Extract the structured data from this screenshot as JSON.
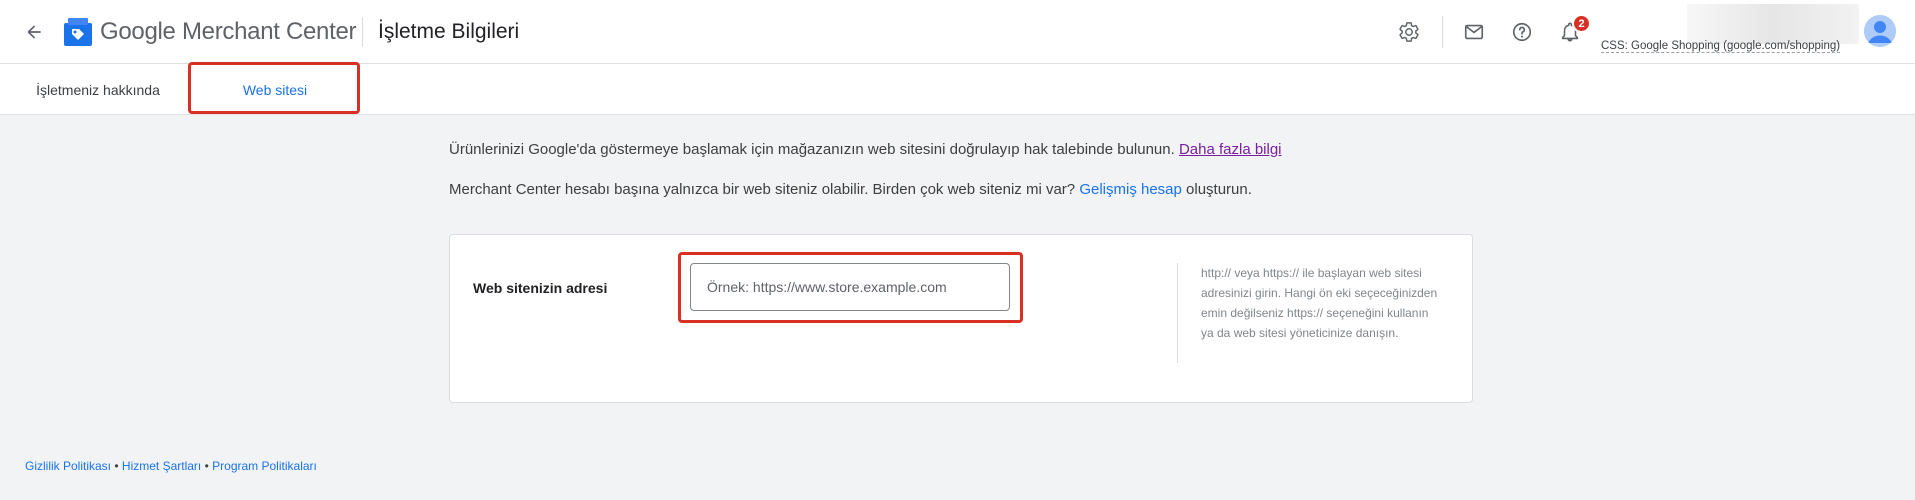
{
  "header": {
    "brand_google": "Google",
    "brand_product": "Merchant Center",
    "page_title": "İşletme Bilgileri",
    "notification_count": "2",
    "account_css": "CSS: Google Shopping (google.com/shopping)",
    "icons": [
      "back-arrow-icon",
      "merchant-center-logo",
      "settings-icon",
      "mail-icon",
      "help-icon",
      "notifications-icon",
      "avatar"
    ],
    "accent_color": "#1a73e8"
  },
  "tabs": [
    {
      "label": "İşletmeniz hakkında",
      "active": false
    },
    {
      "label": "Web sitesi",
      "active": true
    }
  ],
  "intro": {
    "line1_text": "Ürünlerinizi Google'da göstermeye başlamak için mağazanızın web sitesini doğrulayıp hak talebinde bulunun.",
    "line1_link": "Daha fazla bilgi",
    "line2_before": "Merchant Center hesabı başına yalnızca bir web siteniz olabilir. Birden çok web siteniz mi var?",
    "line2_link": "Gelişmiş hesap",
    "line2_after": "oluşturun."
  },
  "website_form": {
    "label": "Web sitenizin adresi",
    "input_value": "",
    "input_placeholder": "Örnek: https://www.store.example.com",
    "help_text": "http:// veya https:// ile başlayan web sitesi adresinizi girin. Hangi ön eki seçeceğinizden emin değilseniz https:// seçeneğini kullanın ya da web sitesi yöneticinize danışın."
  },
  "footer": {
    "links": [
      "Gizlilik Politikası",
      "Hizmet Şartları",
      "Program Politikaları"
    ],
    "separator": "•"
  },
  "highlight_color": "#d93025"
}
